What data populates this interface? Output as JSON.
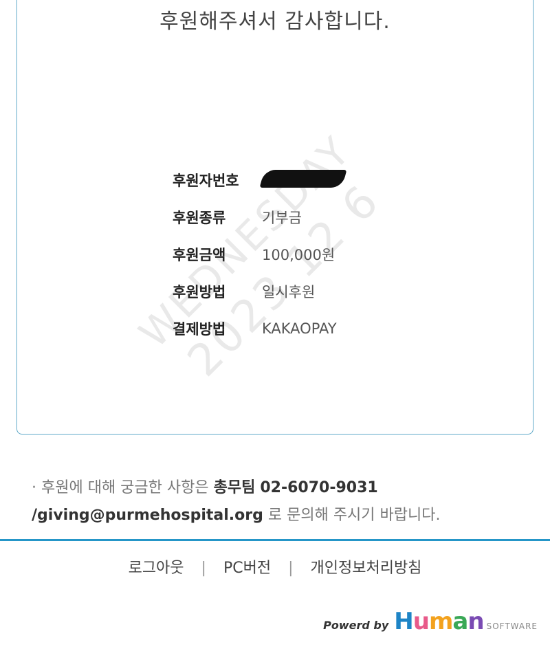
{
  "thanks_message": "후원해주셔서 감사합니다.",
  "watermark": {
    "line1": "WEDNESDAY",
    "line2": "2023 12 6"
  },
  "donation_info": [
    {
      "label": "후원자번호",
      "value": ""
    },
    {
      "label": "후원종류",
      "value": "기부금"
    },
    {
      "label": "후원금액",
      "value": "100,000원"
    },
    {
      "label": "후원방법",
      "value": "일시후원"
    },
    {
      "label": "결제방법",
      "value": "KAKAOPAY"
    }
  ],
  "notice": {
    "prefix": "· 후원에 대해 궁금한 사항은",
    "team": "총무팀",
    "phone": "02-6070-9031",
    "sep": "/",
    "email": "giving@purmehospital.org",
    "suffix": "로 문의해 주시기 바랍니다."
  },
  "footer_nav": [
    {
      "label": "로그아웃"
    },
    {
      "label": "PC버전"
    },
    {
      "label": "개인정보처리방침"
    }
  ],
  "powered": {
    "prefix": "Powerd by",
    "logo": "Human",
    "suffix": "SOFTWARE"
  },
  "colors": {
    "accent": "#2596c8",
    "card_border": "#5fa9c8"
  }
}
